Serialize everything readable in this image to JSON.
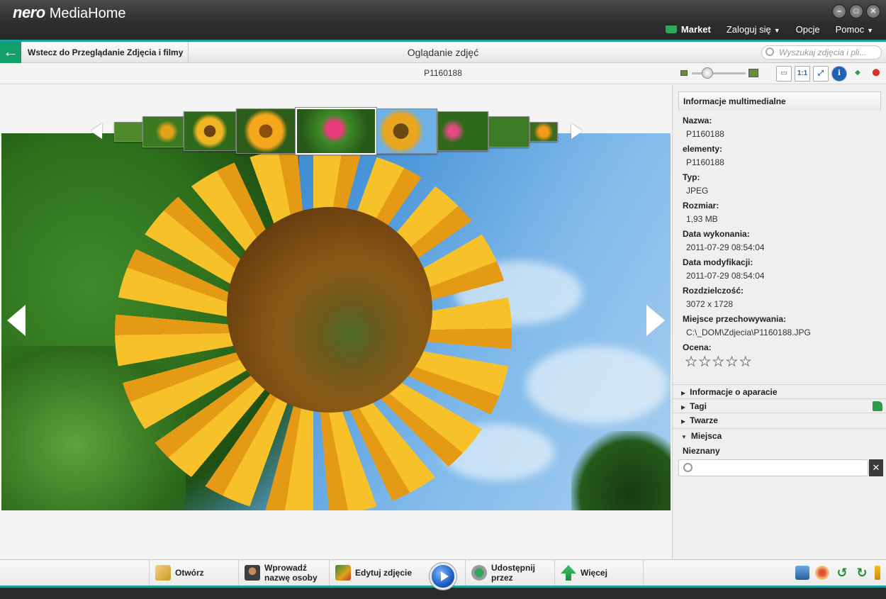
{
  "app": {
    "brand": "nero",
    "name": "MediaHome"
  },
  "window_buttons": [
    "minimize-icon",
    "maximize-icon",
    "close-icon"
  ],
  "topmenu": {
    "market": "Market",
    "login": "Zaloguj się",
    "options": "Opcje",
    "help": "Pomoc"
  },
  "nav": {
    "back_label": "Wstecz do Przeglądanie Zdjęcia i filmy",
    "title": "Oglądanie zdjęć",
    "search_placeholder": "Wyszukaj zdjęcia i pli..."
  },
  "viewer": {
    "filename": "P1160188",
    "view_buttons": [
      "fit-window-icon",
      "actual-size-icon",
      "fullscreen-icon",
      "info-icon",
      "tag-person-icon",
      "location-pin-icon"
    ]
  },
  "filmstrip": {
    "thumbnails": [
      "leaves",
      "sunflower-small",
      "sunflower",
      "sunflower-orange",
      "zinnia-pink",
      "sunflower-sky",
      "zinnia-pink-2",
      "foliage",
      "marigold"
    ],
    "selected_index": 4
  },
  "panel": {
    "tab": "Informacje multimedialne",
    "properties": [
      {
        "label": "Nazwa:",
        "value": "P1160188"
      },
      {
        "label": "elementy:",
        "value": "P1160188"
      },
      {
        "label": "Typ:",
        "value": "JPEG"
      },
      {
        "label": "Rozmiar:",
        "value": "1,93 MB"
      },
      {
        "label": "Data wykonania:",
        "value": "2011-07-29 08:54:04"
      },
      {
        "label": "Data modyfikacji:",
        "value": "2011-07-29 08:54:04"
      },
      {
        "label": "Rozdzielczość:",
        "value": "3072 x 1728"
      },
      {
        "label": "Miejsce przechowywania:",
        "value": "C:\\_DOM\\Zdjecia\\P1160188.JPG"
      }
    ],
    "rating_label": "Ocena:",
    "rating": 0,
    "rating_max": 5,
    "sections": [
      {
        "label": "Informacje o aparacie",
        "expanded": false
      },
      {
        "label": "Tagi",
        "expanded": false
      },
      {
        "label": "Twarze",
        "expanded": false
      },
      {
        "label": "Miejsca",
        "expanded": true
      }
    ],
    "place_value": "Nieznany",
    "place_input": ""
  },
  "toolbar": {
    "open": "Otwórz",
    "name_person_1": "Wprowadź",
    "name_person_2": "nazwę osoby",
    "edit": "Edytuj zdjęcie",
    "share_1": "Udostępnij",
    "share_2": "przez",
    "more": "Więcej",
    "right_tools": [
      "monitor-icon",
      "paint-icon",
      "rotate-left-icon",
      "rotate-right-icon",
      "marker-icon"
    ]
  },
  "colors": {
    "accent": "#1aa19a",
    "back_button": "#12a06a",
    "titlebar": "#2e2e2e"
  }
}
